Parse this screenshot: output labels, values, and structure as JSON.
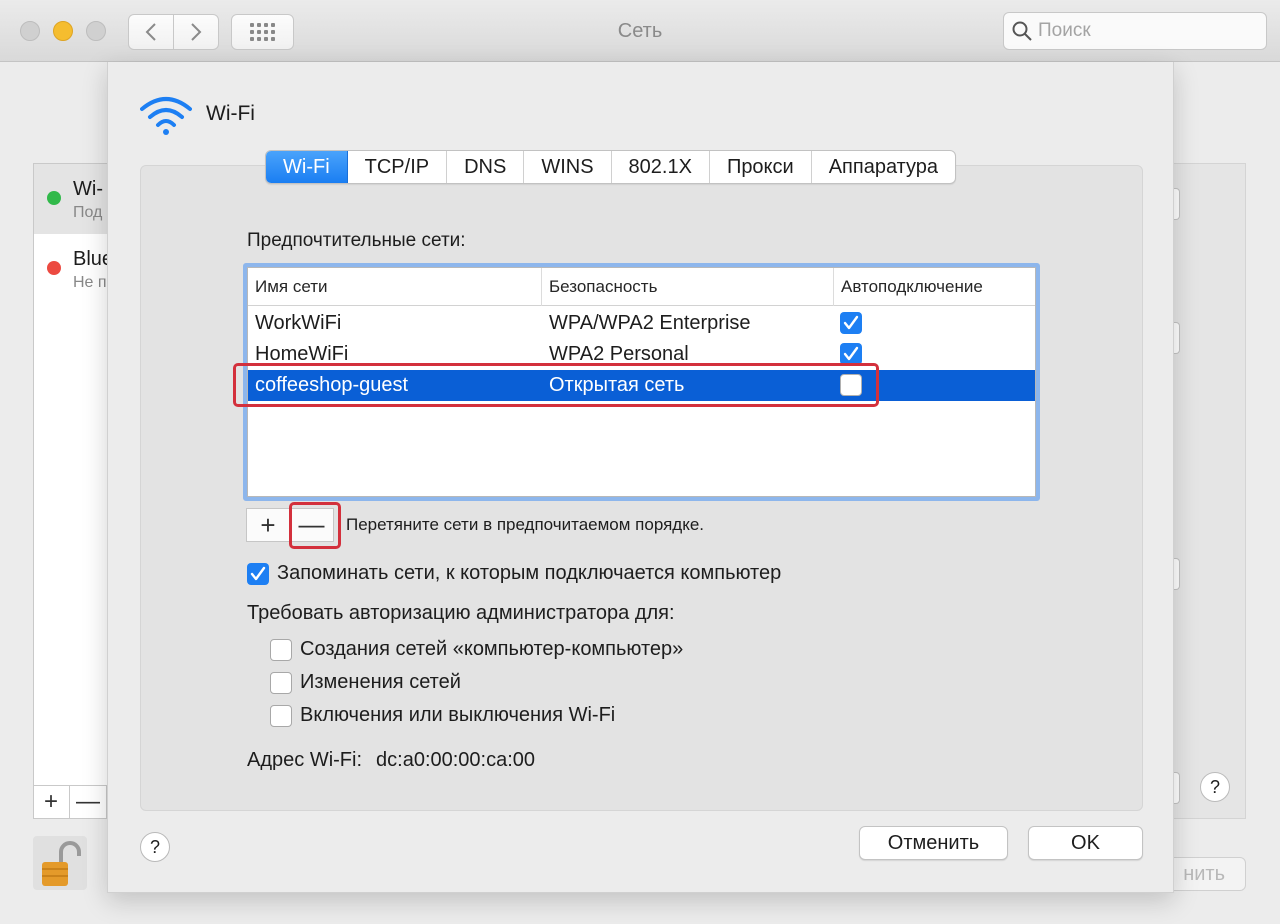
{
  "window": {
    "title": "Сеть",
    "search_placeholder": "Поиск"
  },
  "background": {
    "services": [
      {
        "name": "Wi-",
        "status": "Под",
        "color": "#31b94a"
      },
      {
        "name": "Blue",
        "status": "Не п",
        "color": "#ec4a41"
      }
    ],
    "apply_label": "нить"
  },
  "sheet": {
    "title": "Wi-Fi",
    "tabs": [
      "Wi-Fi",
      "TCP/IP",
      "DNS",
      "WINS",
      "802.1X",
      "Прокси",
      "Аппаратура"
    ],
    "preferred_label": "Предпочтительные сети:",
    "columns": [
      "Имя сети",
      "Безопасность",
      "Автоподключение"
    ],
    "networks": [
      {
        "name": "WorkWiFi",
        "security": "WPA/WPA2 Enterprise",
        "auto": true
      },
      {
        "name": "HomeWiFi",
        "security": "WPA2 Personal",
        "auto": true
      },
      {
        "name": "coffeeshop-guest",
        "security": "Открытая сеть",
        "auto": false
      }
    ],
    "plus_label": "+",
    "minus_label": "—",
    "drag_hint": "Перетяните сети в предпочитаемом порядке.",
    "remember_label": "Запоминать сети, к которым подключается компьютер",
    "require_label": "Требовать авторизацию администратора для:",
    "options": [
      "Создания сетей «компьютер-компьютер»",
      "Изменения сетей",
      "Включения или выключения Wi-Fi"
    ],
    "address_label": "Адрес Wi-Fi:",
    "address_value": "dc:a0:00:00:ca:00",
    "help": "?",
    "cancel_label": "Отменить",
    "ok_label": "OK"
  },
  "colors": {
    "accent": "#1d7ff3",
    "selection": "#0a5fd6",
    "highlight": "#d3303c"
  }
}
